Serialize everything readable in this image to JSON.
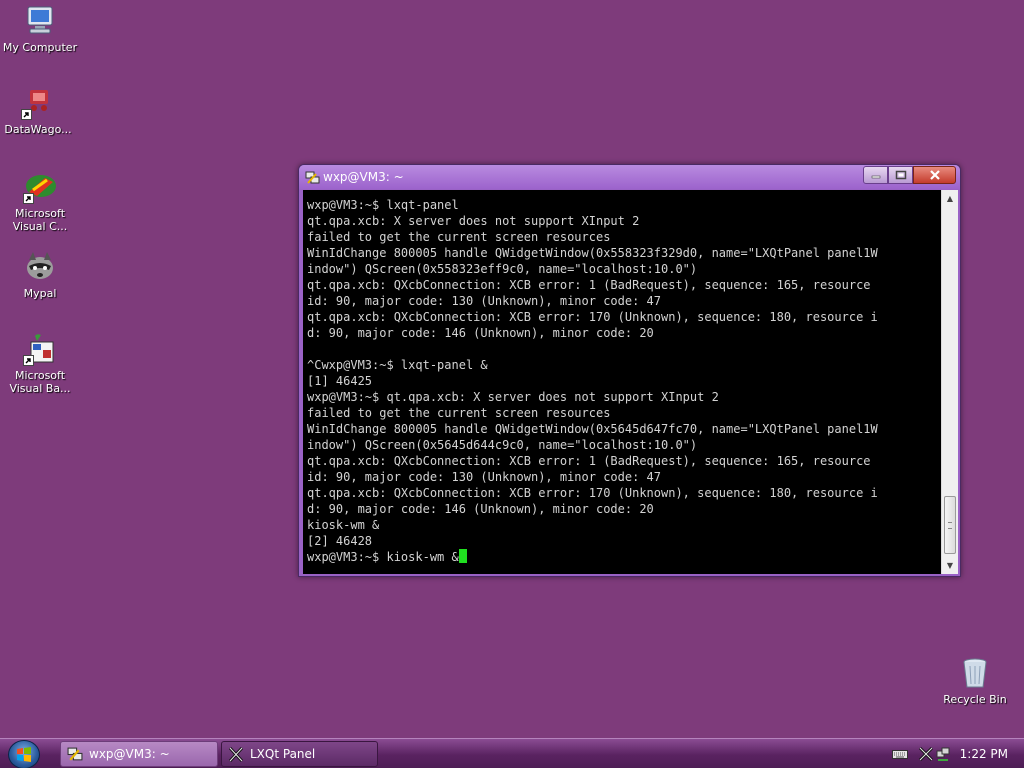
{
  "desktop": {
    "icons": [
      {
        "label": "My Computer",
        "icon": "computer-icon"
      },
      {
        "label": "DataWago...",
        "icon": "datawagon-icon"
      },
      {
        "label": "Microsoft Visual C...",
        "icon": "visual-c-icon"
      },
      {
        "label": "Mypal",
        "icon": "mypal-icon"
      },
      {
        "label": "Microsoft Visual Ba...",
        "icon": "visual-basic-icon"
      },
      {
        "label": "Recycle Bin",
        "icon": "recycle-bin-icon"
      }
    ],
    "background_color": "#7e3b7b"
  },
  "window": {
    "title": "wxp@VM3: ~",
    "terminal_lines": [
      "wxp@VM3:~$ lxqt-panel",
      "qt.qpa.xcb: X server does not support XInput 2",
      "failed to get the current screen resources",
      "WinIdChange 800005 handle QWidgetWindow(0x558323f329d0, name=\"LXQtPanel panel1W",
      "indow\") QScreen(0x558323eff9c0, name=\"localhost:10.0\")",
      "qt.qpa.xcb: QXcbConnection: XCB error: 1 (BadRequest), sequence: 165, resource",
      "id: 90, major code: 130 (Unknown), minor code: 47",
      "qt.qpa.xcb: QXcbConnection: XCB error: 170 (Unknown), sequence: 180, resource i",
      "d: 90, major code: 146 (Unknown), minor code: 20",
      "",
      "^Cwxp@VM3:~$ lxqt-panel &",
      "[1] 46425",
      "wxp@VM3:~$ qt.qpa.xcb: X server does not support XInput 2",
      "failed to get the current screen resources",
      "WinIdChange 800005 handle QWidgetWindow(0x5645d647fc70, name=\"LXQtPanel panel1W",
      "indow\") QScreen(0x5645d644c9c0, name=\"localhost:10.0\")",
      "qt.qpa.xcb: QXcbConnection: XCB error: 1 (BadRequest), sequence: 165, resource",
      "id: 90, major code: 130 (Unknown), minor code: 47",
      "qt.qpa.xcb: QXcbConnection: XCB error: 170 (Unknown), sequence: 180, resource i",
      "d: 90, major code: 146 (Unknown), minor code: 20",
      "kiosk-wm &",
      "[2] 46428"
    ],
    "prompt_line": "wxp@VM3:~$ kiosk-wm &",
    "text_color": "#d3d3d3",
    "cursor_color": "#20e020"
  },
  "taskbar": {
    "tasks": [
      {
        "label": "wxp@VM3: ~",
        "icon": "putty-icon",
        "active": true
      },
      {
        "label": "LXQt Panel",
        "icon": "x-window-icon",
        "active": false
      }
    ],
    "clock": "1:22 PM",
    "tray_icons": [
      "keyboard-icon",
      "x-server-icon",
      "network-icon"
    ]
  }
}
